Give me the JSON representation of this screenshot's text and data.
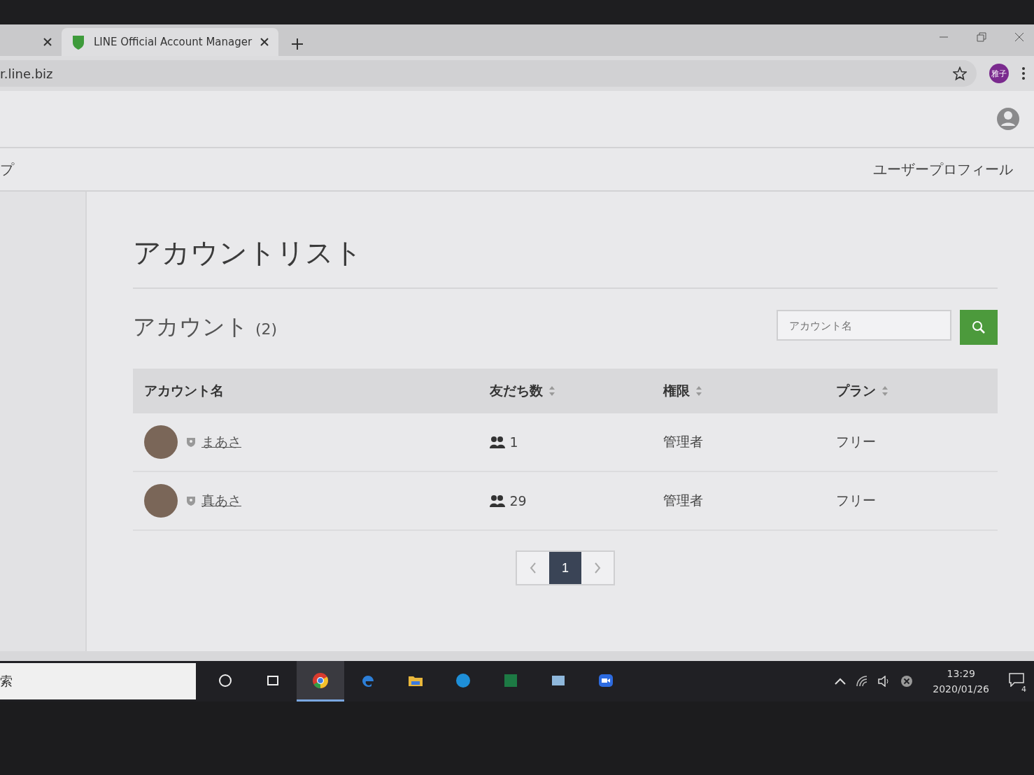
{
  "browser": {
    "tabs": [
      {
        "selected": false
      },
      {
        "title": "LINE Official Account Manager",
        "selected": true
      }
    ],
    "url": "r.line.biz",
    "profile_badge": "雅子"
  },
  "nav": {
    "left_item": "プ",
    "right_item": "ユーザープロフィール"
  },
  "page": {
    "title": "アカウントリスト",
    "section_title": "アカウント",
    "count": "(2)",
    "search": {
      "placeholder": "アカウント名"
    }
  },
  "table": {
    "columns": [
      {
        "label": "アカウント名",
        "sortable": false
      },
      {
        "label": "友だち数",
        "sortable": true
      },
      {
        "label": "権限",
        "sortable": true
      },
      {
        "label": "プラン",
        "sortable": true
      }
    ],
    "rows": [
      {
        "name": "まあさ",
        "friends": "1",
        "role": "管理者",
        "plan": "フリー"
      },
      {
        "name": "真あさ",
        "friends": "29",
        "role": "管理者",
        "plan": "フリー"
      }
    ]
  },
  "pagination": {
    "pages": [
      {
        "label": "1",
        "selected": true
      }
    ]
  },
  "taskbar": {
    "search_text": "索",
    "apps": [
      {
        "kind": "cortana",
        "selected": false
      },
      {
        "kind": "taskview",
        "selected": false
      },
      {
        "kind": "chrome",
        "selected": true
      },
      {
        "kind": "edge",
        "selected": false
      },
      {
        "kind": "folder",
        "selected": false
      },
      {
        "kind": "skype",
        "selected": false
      },
      {
        "kind": "excel",
        "selected": false
      },
      {
        "kind": "photos",
        "selected": false
      },
      {
        "kind": "zoom",
        "selected": false
      }
    ],
    "time": "13:29",
    "date": "2020/01/26",
    "notification_count": "4"
  }
}
